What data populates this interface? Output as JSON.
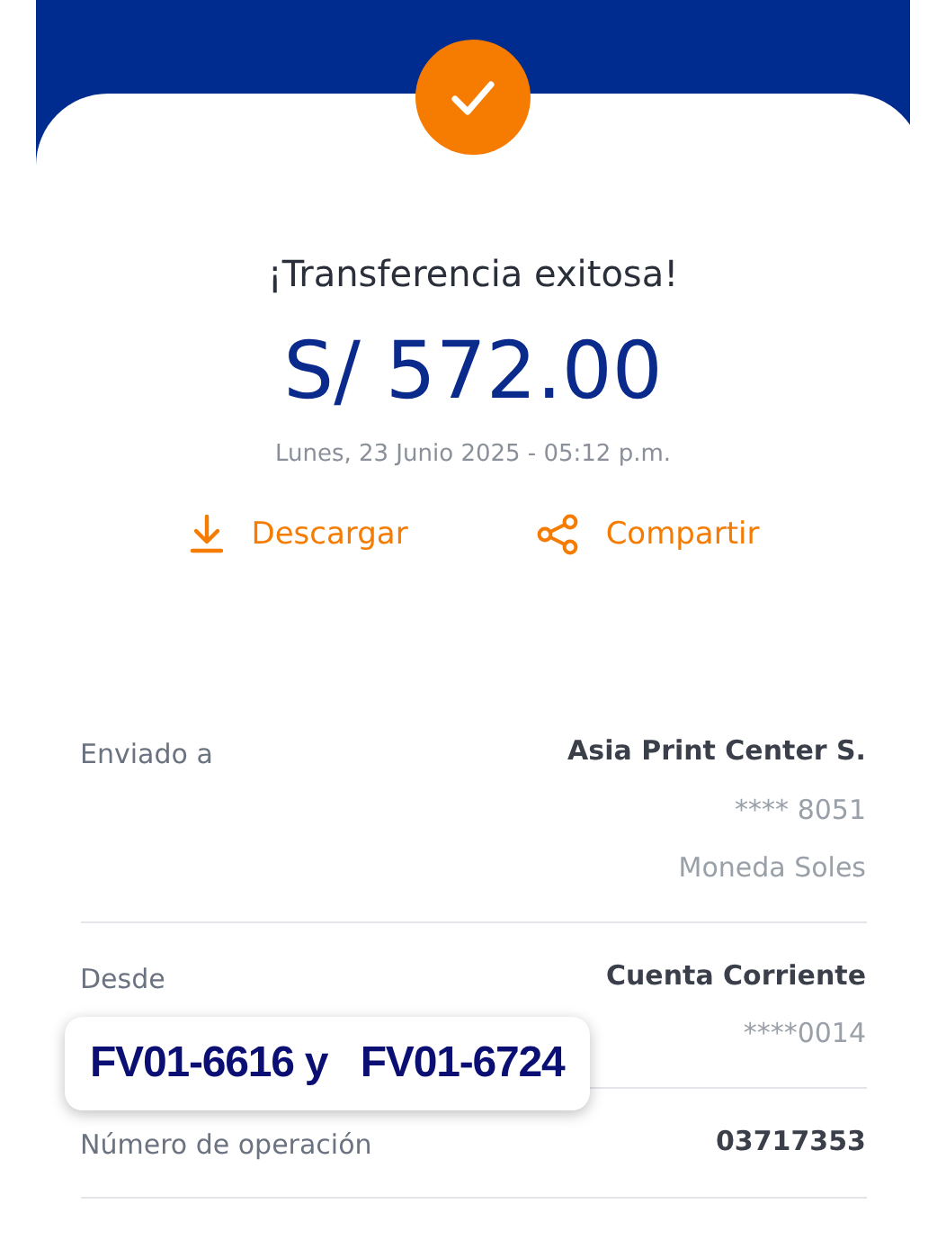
{
  "header": {
    "success": true
  },
  "title": "¡Transferencia exitosa!",
  "amount": "S/ 572.00",
  "date": "Lunes, 23 Junio 2025 - 05:12 p.m.",
  "actions": [
    {
      "kind": "download",
      "label": "Descargar"
    },
    {
      "kind": "share",
      "label": "Compartir"
    }
  ],
  "details": [
    {
      "label": "Enviado a",
      "values": [
        "Asia Print Center S.",
        "**** 8051",
        "Moneda Soles"
      ]
    },
    {
      "label": "Desde",
      "values": [
        "Cuenta Corriente",
        "****0014"
      ]
    },
    {
      "label": "Número de operación",
      "values": [
        "03717353"
      ]
    }
  ],
  "note": "FV01-6616 y   FV01-6724"
}
